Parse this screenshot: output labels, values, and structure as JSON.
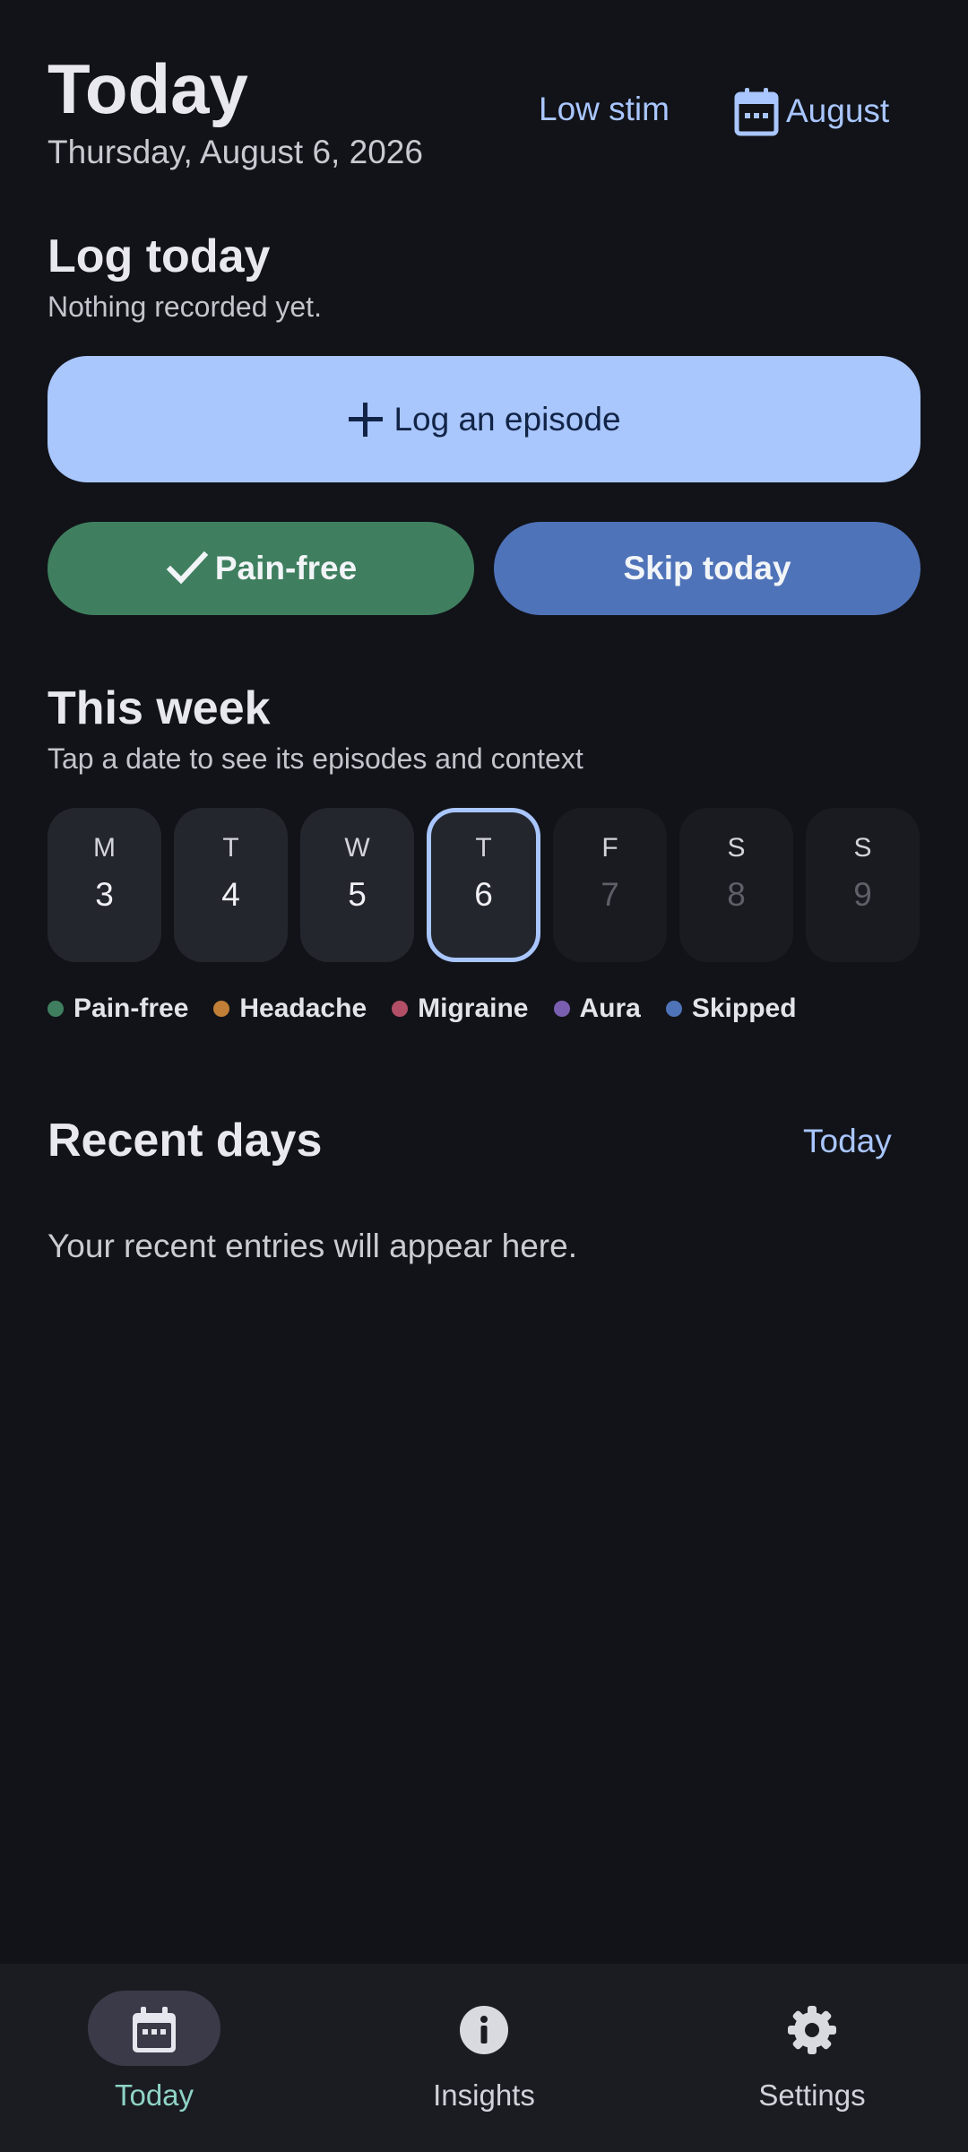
{
  "header": {
    "title": "Today",
    "date": "Thursday, August 6, 2026",
    "low_stim_label": "Low stim",
    "month_label": "August",
    "month_icon": "calendar-icon"
  },
  "log_today": {
    "title": "Log today",
    "subtitle": "Nothing recorded yet.",
    "log_episode_label": "Log an episode",
    "pain_free_label": "Pain-free",
    "skip_label": "Skip today"
  },
  "this_week": {
    "title": "This week",
    "subtitle": "Tap a date to see its episodes and context",
    "days": [
      {
        "letter": "M",
        "num": "3"
      },
      {
        "letter": "T",
        "num": "4"
      },
      {
        "letter": "W",
        "num": "5"
      },
      {
        "letter": "T",
        "num": "6"
      },
      {
        "letter": "F",
        "num": "7"
      },
      {
        "letter": "S",
        "num": "8"
      },
      {
        "letter": "S",
        "num": "9"
      }
    ],
    "selected_index": 3,
    "legend": [
      {
        "label": "Pain-free",
        "color": "#3f7f5f"
      },
      {
        "label": "Headache",
        "color": "#c17f37"
      },
      {
        "label": "Migraine",
        "color": "#b24f66"
      },
      {
        "label": "Aura",
        "color": "#7a5fb0"
      },
      {
        "label": "Skipped",
        "color": "#4f73b9"
      }
    ]
  },
  "recent": {
    "title": "Recent days",
    "today_link": "Today",
    "empty_text": "Your recent entries will appear here."
  },
  "nav": {
    "items": [
      {
        "label": "Today",
        "icon": "calendar-icon",
        "active": true
      },
      {
        "label": "Insights",
        "icon": "info-icon",
        "active": false
      },
      {
        "label": "Settings",
        "icon": "gear-icon",
        "active": false
      }
    ]
  },
  "colors": {
    "accent": "#a9c6ff",
    "background": "#111318",
    "nav_active": "#8fd3c6"
  }
}
